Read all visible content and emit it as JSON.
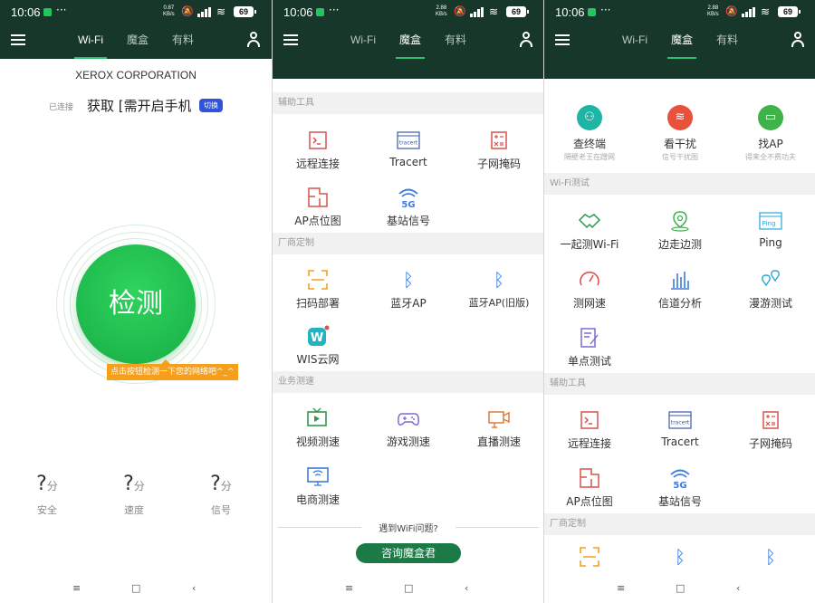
{
  "status": {
    "time": "10:06",
    "more": "···",
    "speed1": "0.87",
    "speed2": "2.88",
    "speed3": "2.88",
    "speed_unit": "KB/s",
    "battery": "69"
  },
  "tabs": [
    "Wi-Fi",
    "魔盒",
    "有料"
  ],
  "panel1": {
    "company": "XEROX CORPORATION",
    "connected_label": "已连接",
    "ssid": "获取 [需开启手机",
    "switch": "切换",
    "detect": "检测",
    "hint": "点击按钮检测一下您的网络吧^_^",
    "stats": [
      {
        "value": "?",
        "unit": "分",
        "label": "安全"
      },
      {
        "value": "?",
        "unit": "分",
        "label": "速度"
      },
      {
        "value": "?",
        "unit": "分",
        "label": "信号"
      }
    ]
  },
  "panel2": {
    "sec_tools": "辅助工具",
    "tools": [
      "远程连接",
      "Tracert",
      "子网掩码",
      "AP点位图",
      "基站信号"
    ],
    "sec_vendor": "厂商定制",
    "vendor": [
      "扫码部署",
      "蓝牙AP",
      "蓝牙AP(旧版)",
      "WIS云网"
    ],
    "sec_business": "业务测速",
    "business": [
      "视频测速",
      "游戏测速",
      "直播测速",
      "电商测速"
    ],
    "help_text": "遇到WiFi问题?",
    "help_button": "咨询魔盒君"
  },
  "panel3": {
    "top": [
      {
        "label": "查终端",
        "sub": "隔壁老王在蹭网"
      },
      {
        "label": "看干扰",
        "sub": "信号干扰图"
      },
      {
        "label": "找AP",
        "sub": "得来全不费功夫"
      }
    ],
    "sec_wifi": "Wi-Fi测试",
    "wifi": [
      "一起测Wi-Fi",
      "边走边测",
      "Ping",
      "测网速",
      "信道分析",
      "漫游测试",
      "单点测试"
    ],
    "sec_tools": "辅助工具",
    "tools": [
      "远程连接",
      "Tracert",
      "子网掩码",
      "AP点位图",
      "基站信号"
    ],
    "sec_vendor": "厂商定制"
  },
  "icons": {
    "tracert": "tracert",
    "ping": "Ping",
    "fiveg": "5G",
    "wis": "W",
    "terminal": ">_",
    "bluetooth": "ᛒ"
  },
  "colors": {
    "dark": "#17372a",
    "accent": "#2fbf71",
    "red": "#d9534f",
    "orange": "#f59f1b",
    "green": "#1eb94c",
    "blue": "#3d7be0"
  }
}
